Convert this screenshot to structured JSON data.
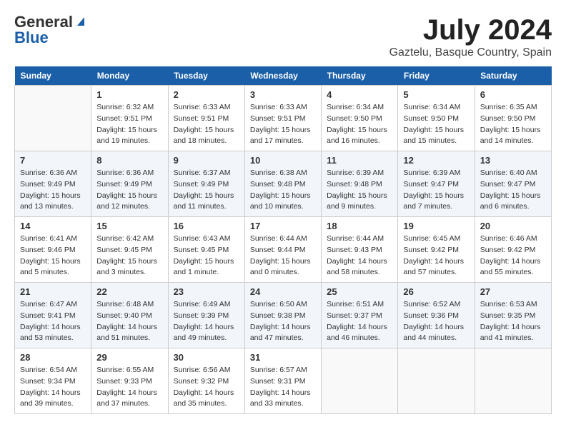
{
  "header": {
    "logo_general": "General",
    "logo_blue": "Blue",
    "title": "July 2024",
    "subtitle": "Gaztelu, Basque Country, Spain"
  },
  "days_of_week": [
    "Sunday",
    "Monday",
    "Tuesday",
    "Wednesday",
    "Thursday",
    "Friday",
    "Saturday"
  ],
  "weeks": [
    [
      {
        "day": "",
        "info": ""
      },
      {
        "day": "1",
        "info": "Sunrise: 6:32 AM\nSunset: 9:51 PM\nDaylight: 15 hours\nand 19 minutes."
      },
      {
        "day": "2",
        "info": "Sunrise: 6:33 AM\nSunset: 9:51 PM\nDaylight: 15 hours\nand 18 minutes."
      },
      {
        "day": "3",
        "info": "Sunrise: 6:33 AM\nSunset: 9:51 PM\nDaylight: 15 hours\nand 17 minutes."
      },
      {
        "day": "4",
        "info": "Sunrise: 6:34 AM\nSunset: 9:50 PM\nDaylight: 15 hours\nand 16 minutes."
      },
      {
        "day": "5",
        "info": "Sunrise: 6:34 AM\nSunset: 9:50 PM\nDaylight: 15 hours\nand 15 minutes."
      },
      {
        "day": "6",
        "info": "Sunrise: 6:35 AM\nSunset: 9:50 PM\nDaylight: 15 hours\nand 14 minutes."
      }
    ],
    [
      {
        "day": "7",
        "info": "Sunrise: 6:36 AM\nSunset: 9:49 PM\nDaylight: 15 hours\nand 13 minutes."
      },
      {
        "day": "8",
        "info": "Sunrise: 6:36 AM\nSunset: 9:49 PM\nDaylight: 15 hours\nand 12 minutes."
      },
      {
        "day": "9",
        "info": "Sunrise: 6:37 AM\nSunset: 9:49 PM\nDaylight: 15 hours\nand 11 minutes."
      },
      {
        "day": "10",
        "info": "Sunrise: 6:38 AM\nSunset: 9:48 PM\nDaylight: 15 hours\nand 10 minutes."
      },
      {
        "day": "11",
        "info": "Sunrise: 6:39 AM\nSunset: 9:48 PM\nDaylight: 15 hours\nand 9 minutes."
      },
      {
        "day": "12",
        "info": "Sunrise: 6:39 AM\nSunset: 9:47 PM\nDaylight: 15 hours\nand 7 minutes."
      },
      {
        "day": "13",
        "info": "Sunrise: 6:40 AM\nSunset: 9:47 PM\nDaylight: 15 hours\nand 6 minutes."
      }
    ],
    [
      {
        "day": "14",
        "info": "Sunrise: 6:41 AM\nSunset: 9:46 PM\nDaylight: 15 hours\nand 5 minutes."
      },
      {
        "day": "15",
        "info": "Sunrise: 6:42 AM\nSunset: 9:45 PM\nDaylight: 15 hours\nand 3 minutes."
      },
      {
        "day": "16",
        "info": "Sunrise: 6:43 AM\nSunset: 9:45 PM\nDaylight: 15 hours\nand 1 minute."
      },
      {
        "day": "17",
        "info": "Sunrise: 6:44 AM\nSunset: 9:44 PM\nDaylight: 15 hours\nand 0 minutes."
      },
      {
        "day": "18",
        "info": "Sunrise: 6:44 AM\nSunset: 9:43 PM\nDaylight: 14 hours\nand 58 minutes."
      },
      {
        "day": "19",
        "info": "Sunrise: 6:45 AM\nSunset: 9:42 PM\nDaylight: 14 hours\nand 57 minutes."
      },
      {
        "day": "20",
        "info": "Sunrise: 6:46 AM\nSunset: 9:42 PM\nDaylight: 14 hours\nand 55 minutes."
      }
    ],
    [
      {
        "day": "21",
        "info": "Sunrise: 6:47 AM\nSunset: 9:41 PM\nDaylight: 14 hours\nand 53 minutes."
      },
      {
        "day": "22",
        "info": "Sunrise: 6:48 AM\nSunset: 9:40 PM\nDaylight: 14 hours\nand 51 minutes."
      },
      {
        "day": "23",
        "info": "Sunrise: 6:49 AM\nSunset: 9:39 PM\nDaylight: 14 hours\nand 49 minutes."
      },
      {
        "day": "24",
        "info": "Sunrise: 6:50 AM\nSunset: 9:38 PM\nDaylight: 14 hours\nand 47 minutes."
      },
      {
        "day": "25",
        "info": "Sunrise: 6:51 AM\nSunset: 9:37 PM\nDaylight: 14 hours\nand 46 minutes."
      },
      {
        "day": "26",
        "info": "Sunrise: 6:52 AM\nSunset: 9:36 PM\nDaylight: 14 hours\nand 44 minutes."
      },
      {
        "day": "27",
        "info": "Sunrise: 6:53 AM\nSunset: 9:35 PM\nDaylight: 14 hours\nand 41 minutes."
      }
    ],
    [
      {
        "day": "28",
        "info": "Sunrise: 6:54 AM\nSunset: 9:34 PM\nDaylight: 14 hours\nand 39 minutes."
      },
      {
        "day": "29",
        "info": "Sunrise: 6:55 AM\nSunset: 9:33 PM\nDaylight: 14 hours\nand 37 minutes."
      },
      {
        "day": "30",
        "info": "Sunrise: 6:56 AM\nSunset: 9:32 PM\nDaylight: 14 hours\nand 35 minutes."
      },
      {
        "day": "31",
        "info": "Sunrise: 6:57 AM\nSunset: 9:31 PM\nDaylight: 14 hours\nand 33 minutes."
      },
      {
        "day": "",
        "info": ""
      },
      {
        "day": "",
        "info": ""
      },
      {
        "day": "",
        "info": ""
      }
    ]
  ]
}
